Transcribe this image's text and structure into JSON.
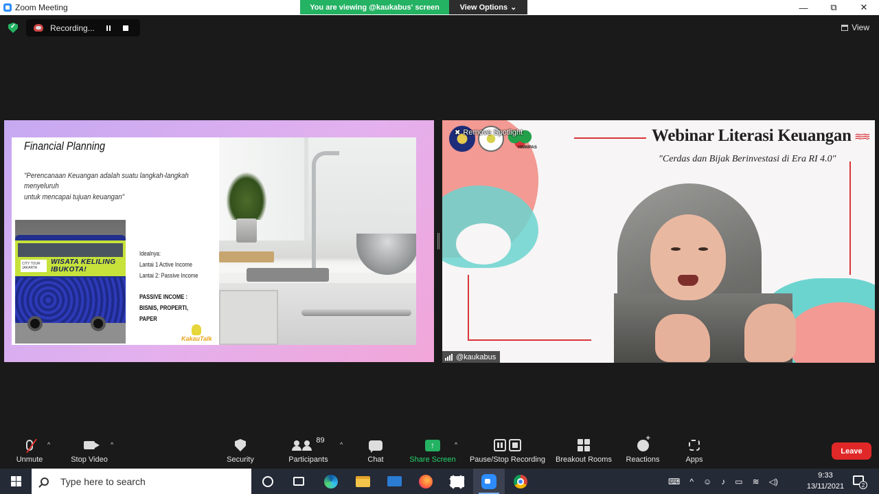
{
  "window": {
    "title": "Zoom Meeting",
    "viewing_banner": "You are viewing @kaukabus' screen",
    "view_options": "View Options",
    "minimize": "—",
    "restore": "⧉",
    "close": "✕"
  },
  "recording": {
    "label": "Recording..."
  },
  "view_button": "View",
  "shared_slide": {
    "title": "Financial Planning",
    "quote_line1": "\"Perencanaan Keuangan adalah suatu langkah-langkah menyeluruh",
    "quote_line2": "untuk mencapai tujuan keuangan\"",
    "bus_text": "WISATA KELILING IBUKOTA!",
    "bus_logo": "CITY TOUR JAKARTA",
    "ideal_label": "Idealnya:",
    "floor1": "Lantai 1 Active Income",
    "floor2": "Lantai 2: Passive Income",
    "passive_heading": "PASSIVE INCOME :",
    "passive_items": "BISNIS, PROPERTI, PAPER",
    "brand": "KakauTalk"
  },
  "speaker_video": {
    "remove_spotlight": "Remove Spotlight",
    "webinar_title": "Webinar Literasi Keuangan",
    "webinar_subtitle": "\"Cerdas dan Bijak Berinvestasi di Era RI 4.0\"",
    "org_label": "HIMMPAS",
    "participant_name": "@kaukabus"
  },
  "toolbar": {
    "unmute": "Unmute",
    "stop_video": "Stop Video",
    "security": "Security",
    "participants": "Participants",
    "participant_count": "89",
    "chat": "Chat",
    "share_screen": "Share Screen",
    "pause_stop_recording": "Pause/Stop Recording",
    "breakout_rooms": "Breakout Rooms",
    "reactions": "Reactions",
    "apps": "Apps",
    "leave": "Leave"
  },
  "taskbar": {
    "search_placeholder": "Type here to search",
    "time": "9:33",
    "date": "13/11/2021",
    "notification_count": "2",
    "apps": [
      "cortana-icon",
      "task-view-icon",
      "edge-icon",
      "file-explorer-icon",
      "mail-icon",
      "firefox-icon",
      "dropbox-icon",
      "zoom-icon",
      "chrome-icon"
    ]
  },
  "colors": {
    "green_banner": "#24b263",
    "leave_red": "#e02828",
    "accent_red": "#d9343a",
    "teal": "#6cd4cf",
    "salmon": "#f29a93"
  }
}
